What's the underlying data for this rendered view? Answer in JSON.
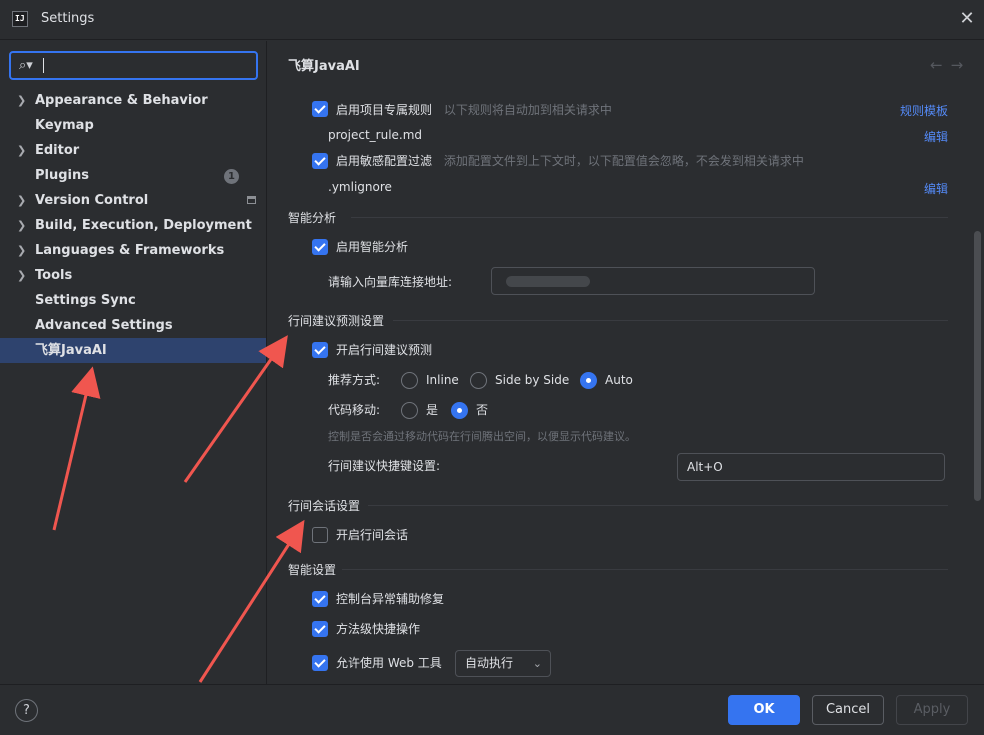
{
  "window": {
    "title": "Settings",
    "app_icon": "IJ"
  },
  "search": {
    "placeholder": ""
  },
  "sidebar": {
    "items": [
      {
        "label": "Appearance & Behavior",
        "expandable": true
      },
      {
        "label": "Keymap",
        "expandable": false
      },
      {
        "label": "Editor",
        "expandable": true
      },
      {
        "label": "Plugins",
        "expandable": false,
        "badge": "1"
      },
      {
        "label": "Version Control",
        "expandable": true
      },
      {
        "label": "Build, Execution, Deployment",
        "expandable": true
      },
      {
        "label": "Languages & Frameworks",
        "expandable": true
      },
      {
        "label": "Tools",
        "expandable": true
      },
      {
        "label": "Settings Sync",
        "expandable": false
      },
      {
        "label": "Advanced Settings",
        "expandable": false
      },
      {
        "label": "飞算JavaAI",
        "expandable": false,
        "selected": true
      }
    ]
  },
  "main": {
    "title": "飞算JavaAI",
    "project_rules": {
      "checkbox_label": "启用项目专属规则",
      "checked": true,
      "hint": "以下规则将自动加到相关请求中",
      "link": "规则模板",
      "file": "project_rule.md",
      "edit_link": "编辑"
    },
    "sensitive_filter": {
      "checkbox_label": "启用敏感配置过滤",
      "checked": true,
      "hint": "添加配置文件到上下文时，以下配置值会忽略，不会发到相关请求中",
      "file": ".ymlignore",
      "edit_link": "编辑"
    },
    "smart_analysis": {
      "section": "智能分析",
      "checkbox_label": "启用智能分析",
      "checked": true,
      "url_label": "请输入向量库连接地址:"
    },
    "inline_prediction": {
      "section": "行间建议预测设置",
      "checkbox_label": "开启行间建议预测",
      "checked": true,
      "mode_label": "推荐方式:",
      "modes": [
        "Inline",
        "Side by Side",
        "Auto"
      ],
      "selected_mode": "Auto",
      "move_label": "代码移动:",
      "move_options": [
        "是",
        "否"
      ],
      "selected_move": "否",
      "move_hint": "控制是否会通过移动代码在行间腾出空间，以便显示代码建议。",
      "shortcut_label": "行间建议快捷键设置:",
      "shortcut_value": "Alt+O"
    },
    "inline_chat": {
      "section": "行间会话设置",
      "checkbox_label": "开启行间会话",
      "checked": false
    },
    "smart_settings": {
      "section": "智能设置",
      "items": [
        {
          "label": "控制台异常辅助修复",
          "checked": true
        },
        {
          "label": "方法级快捷操作",
          "checked": true
        },
        {
          "label": "允许使用 Web 工具",
          "checked": true
        }
      ],
      "web_tool_mode": "自动执行"
    }
  },
  "footer": {
    "help": "?",
    "ok": "OK",
    "cancel": "Cancel",
    "apply": "Apply"
  },
  "colors": {
    "accent": "#3574f0",
    "annotation_arrow": "#f0564f",
    "link": "#548af7"
  }
}
